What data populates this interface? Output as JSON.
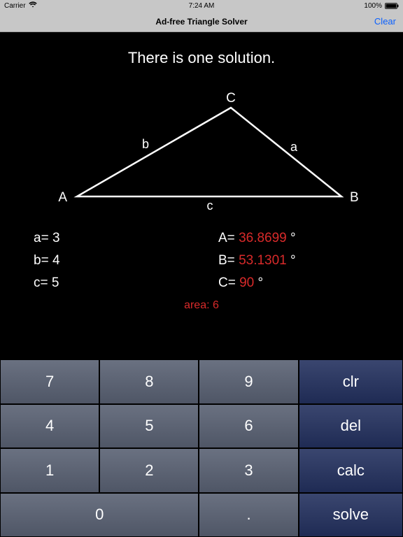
{
  "status": {
    "carrier": "Carrier",
    "time": "7:24 AM",
    "battery": "100%"
  },
  "nav": {
    "title": "Ad-free Triangle Solver",
    "clear": "Clear"
  },
  "solution_text": "There is one solution.",
  "triangle": {
    "vertex_A": "A",
    "vertex_B": "B",
    "vertex_C": "C",
    "side_a": "a",
    "side_b": "b",
    "side_c": "c"
  },
  "sides": {
    "a_label": "a= ",
    "a_value": "3",
    "b_label": "b= ",
    "b_value": "4",
    "c_label": "c= ",
    "c_value": "5"
  },
  "angles": {
    "A_label": "A= ",
    "A_value": "36.8699",
    "A_unit": " °",
    "B_label": "B= ",
    "B_value": "53.1301",
    "B_unit": " °",
    "C_label": "C= ",
    "C_value": "90",
    "C_unit": " °"
  },
  "area": {
    "label": "area: ",
    "value": "6"
  },
  "keys": {
    "k7": "7",
    "k8": "8",
    "k9": "9",
    "clr": "clr",
    "k4": "4",
    "k5": "5",
    "k6": "6",
    "del": "del",
    "k1": "1",
    "k2": "2",
    "k3": "3",
    "calc": "calc",
    "k0": "0",
    "dot": ".",
    "solve": "solve"
  }
}
